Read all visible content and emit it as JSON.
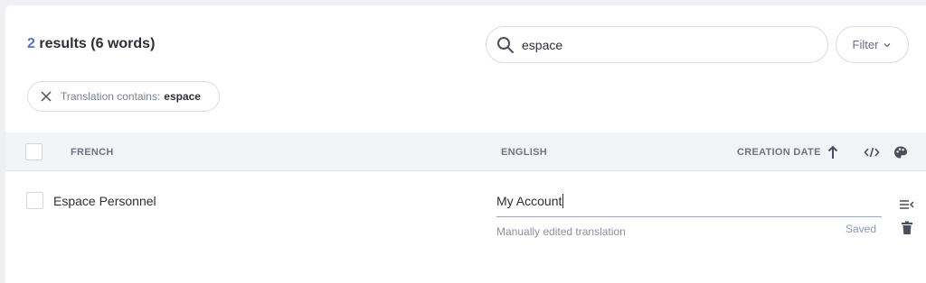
{
  "summary": {
    "count": "2",
    "label": "results (6 words)"
  },
  "search": {
    "value": "espace",
    "icon": "search-icon"
  },
  "filter": {
    "label": "Filter",
    "icon": "chevron-down-icon"
  },
  "active_filter": {
    "prefix": "Translation contains:",
    "value": "espace",
    "icon": "close-icon"
  },
  "table": {
    "columns": {
      "source": "FRENCH",
      "target": "ENGLISH",
      "date": "CREATION DATE"
    },
    "header_icons": [
      "sort-arrow-up-icon",
      "code-icon",
      "palette-icon"
    ],
    "rows": [
      {
        "source": "Espace Personnel",
        "target": "My Account",
        "note": "Manually edited translation",
        "status": "Saved",
        "row_icons": [
          "list-edit-icon",
          "trash-icon"
        ]
      }
    ]
  },
  "colors": {
    "accent": "#5a73c8",
    "header_bg": "#f3f4f7",
    "page_bg": "#eef0f4"
  }
}
